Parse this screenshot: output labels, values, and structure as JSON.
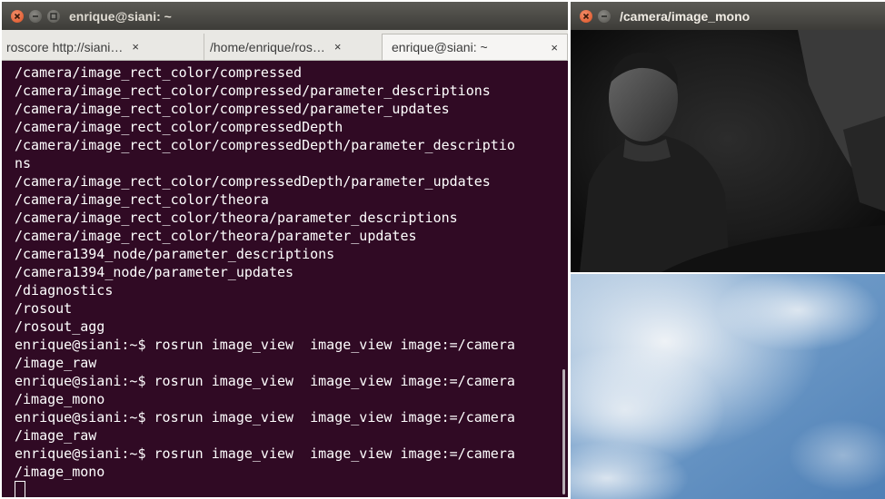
{
  "terminal": {
    "window_title": "enrique@siani: ~",
    "tabs": [
      {
        "label": "roscore http://siani…",
        "close": "×"
      },
      {
        "label": "/home/enrique/ros…",
        "close": "×"
      },
      {
        "label": "enrique@siani: ~",
        "close": "×"
      }
    ],
    "lines": [
      "/camera/image_rect_color/compressed",
      "/camera/image_rect_color/compressed/parameter_descriptions",
      "/camera/image_rect_color/compressed/parameter_updates",
      "/camera/image_rect_color/compressedDepth",
      "/camera/image_rect_color/compressedDepth/parameter_descriptio",
      "ns",
      "/camera/image_rect_color/compressedDepth/parameter_updates",
      "/camera/image_rect_color/theora",
      "/camera/image_rect_color/theora/parameter_descriptions",
      "/camera/image_rect_color/theora/parameter_updates",
      "/camera1394_node/parameter_descriptions",
      "/camera1394_node/parameter_updates",
      "/diagnostics",
      "/rosout",
      "/rosout_agg",
      "enrique@siani:~$ rosrun image_view  image_view image:=/camera",
      "/image_raw",
      "enrique@siani:~$ rosrun image_view  image_view image:=/camera",
      "/image_mono",
      "enrique@siani:~$ rosrun image_view  image_view image:=/camera",
      "/image_raw",
      "enrique@siani:~$ rosrun image_view  image_view image:=/camera",
      "/image_mono"
    ]
  },
  "image_window": {
    "title": "/camera/image_mono"
  },
  "colors": {
    "terminal_bg": "#300a24",
    "titlebar": "#3d3c38",
    "close_button": "#d94f22"
  }
}
